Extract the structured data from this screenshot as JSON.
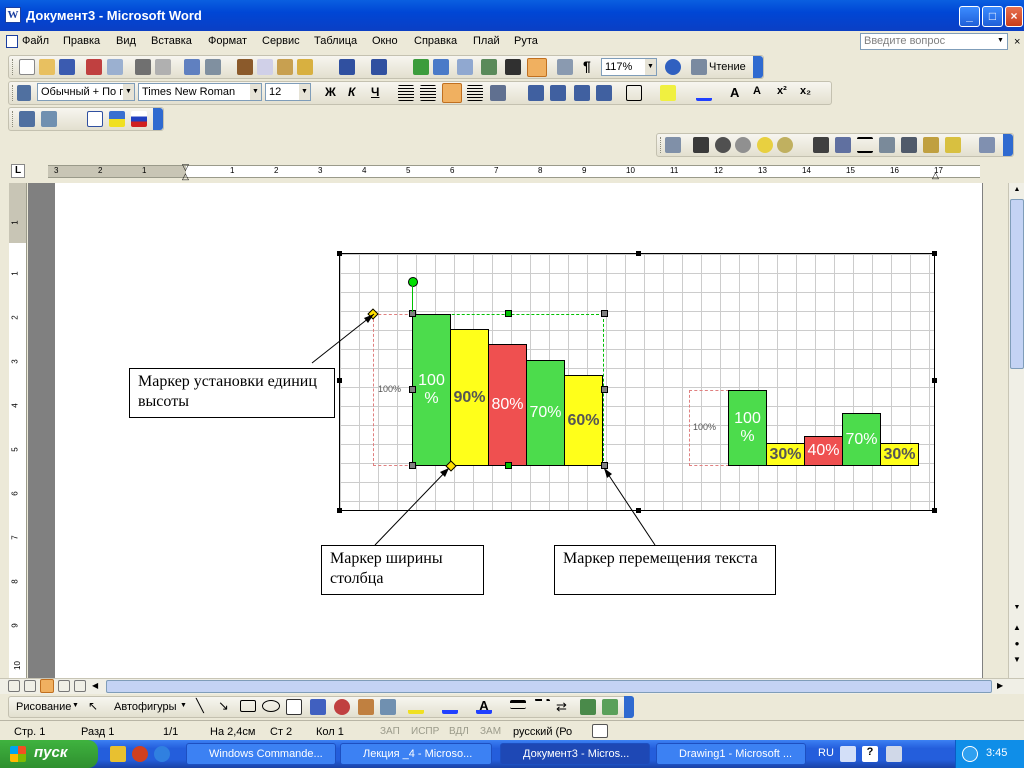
{
  "window": {
    "title": "Документ3 - Microsoft Word",
    "app_letter": "W",
    "buttons": [
      "_",
      "□",
      "×"
    ]
  },
  "menu": [
    "Файл",
    "Правка",
    "Вид",
    "Вставка",
    "Формат",
    "Сервис",
    "Таблица",
    "Окно",
    "Справка",
    "Плай",
    "Рута"
  ],
  "ask_placeholder": "Введите вопрос",
  "standard_toolbar": {
    "zoom": "117%",
    "pilcrow": "¶",
    "reading_label": "Чтение"
  },
  "format_toolbar": {
    "style": "Обычный + По г",
    "font": "Times New Roman",
    "size": "12",
    "bold": "Ж",
    "italic": "К",
    "underline": "Ч",
    "superscript": "x²",
    "subscript": "x₂"
  },
  "ruler": {
    "corner": "L",
    "top_numbers": [
      "3",
      "2",
      "1",
      "1",
      "2",
      "3",
      "4",
      "5",
      "6",
      "7",
      "8",
      "9",
      "10",
      "11",
      "12",
      "13",
      "14",
      "15",
      "16",
      "17"
    ],
    "side_numbers": [
      "1",
      "1",
      "2",
      "3",
      "4",
      "5",
      "6",
      "7",
      "8",
      "9",
      "10"
    ]
  },
  "callouts": {
    "height_marker": "Маркер установки единиц высоты",
    "width_marker": "Маркер ширины столбца",
    "text_move_marker": "Маркер перемещения текста"
  },
  "chart_data": [
    {
      "type": "bar",
      "unit_label": "100%",
      "categories": [
        "100 %",
        "90%",
        "80%",
        "70%",
        "60%"
      ],
      "values": [
        100,
        90,
        80,
        70,
        60
      ],
      "colors": [
        "#4cdc4c",
        "#ffff1a",
        "#ef5050",
        "#4cdc4c",
        "#ffff1a"
      ]
    },
    {
      "type": "bar",
      "unit_label": "100%",
      "categories": [
        "100 %",
        "30%",
        "40%",
        "70%",
        "30%"
      ],
      "values": [
        100,
        30,
        40,
        70,
        30
      ],
      "colors": [
        "#4cdc4c",
        "#ffff1a",
        "#ef5050",
        "#4cdc4c",
        "#ffff1a"
      ]
    }
  ],
  "drawing_toolbar": {
    "draw_label": "Рисование",
    "autoshapes_label": "Автофигуры"
  },
  "status": {
    "page": "Стр. 1",
    "section": "Разд 1",
    "pages": "1/1",
    "at": "На 2,4см",
    "line": "Ст 2",
    "col": "Кол 1",
    "rec": "ЗАП",
    "trk": "ИСПР",
    "ext": "ВДЛ",
    "ovr": "ЗАМ",
    "lang": "русский (Ро"
  },
  "taskbar": {
    "start": "пуск",
    "tasks": [
      "Windows Commande...",
      "Лекция _4 - Microso...",
      "Документ3 - Micros...",
      "Drawing1 - Microsoft ..."
    ],
    "lang": "RU",
    "time": "3:45"
  }
}
